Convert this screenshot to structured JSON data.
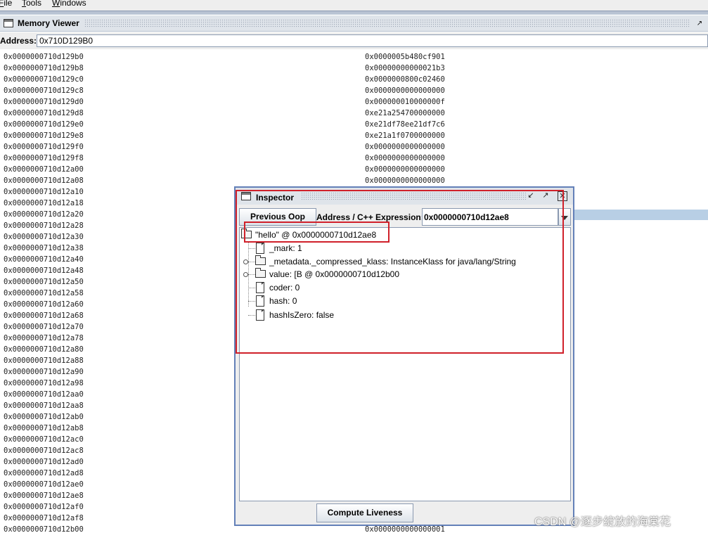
{
  "menubar": {
    "items": [
      {
        "label": "File",
        "mnemonic_index": 0
      },
      {
        "label": "Tools",
        "mnemonic_index": 0
      },
      {
        "label": "Windows",
        "mnemonic_index": 0
      }
    ]
  },
  "memory_viewer": {
    "title": "Memory Viewer",
    "address_label": "Address:",
    "address_value": "0x710D129B0",
    "rows": [
      {
        "addr": "0x0000000710d129b0",
        "val": "0x0000005b480cf901"
      },
      {
        "addr": "0x0000000710d129b8",
        "val": "0x00000000000021b3"
      },
      {
        "addr": "0x0000000710d129c0",
        "val": "0x0000000800c02460"
      },
      {
        "addr": "0x0000000710d129c8",
        "val": "0x0000000000000000"
      },
      {
        "addr": "0x0000000710d129d0",
        "val": "0x000000010000000f"
      },
      {
        "addr": "0x0000000710d129d8",
        "val": "0xe21a254700000000"
      },
      {
        "addr": "0x0000000710d129e0",
        "val": "0xe21df78ee21df7c6"
      },
      {
        "addr": "0x0000000710d129e8",
        "val": "0xe21a1f0700000000"
      },
      {
        "addr": "0x0000000710d129f0",
        "val": "0x0000000000000000"
      },
      {
        "addr": "0x0000000710d129f8",
        "val": "0x0000000000000000"
      },
      {
        "addr": "0x0000000710d12a00",
        "val": "0x0000000000000000"
      },
      {
        "addr": "0x0000000710d12a08",
        "val": "0x0000000000000000"
      },
      {
        "addr": "0x0000000710d12a10",
        "val": ""
      },
      {
        "addr": "0x0000000710d12a18",
        "val": ""
      },
      {
        "addr": "0x0000000710d12a20",
        "val": ""
      },
      {
        "addr": "0x0000000710d12a28",
        "val": ""
      },
      {
        "addr": "0x0000000710d12a30",
        "val": ""
      },
      {
        "addr": "0x0000000710d12a38",
        "val": ""
      },
      {
        "addr": "0x0000000710d12a40",
        "val": ""
      },
      {
        "addr": "0x0000000710d12a48",
        "val": ""
      },
      {
        "addr": "0x0000000710d12a50",
        "val": ""
      },
      {
        "addr": "0x0000000710d12a58",
        "val": ""
      },
      {
        "addr": "0x0000000710d12a60",
        "val": ""
      },
      {
        "addr": "0x0000000710d12a68",
        "val": ""
      },
      {
        "addr": "0x0000000710d12a70",
        "val": ""
      },
      {
        "addr": "0x0000000710d12a78",
        "val": ""
      },
      {
        "addr": "0x0000000710d12a80",
        "val": ""
      },
      {
        "addr": "0x0000000710d12a88",
        "val": ""
      },
      {
        "addr": "0x0000000710d12a90",
        "val": ""
      },
      {
        "addr": "0x0000000710d12a98",
        "val": ""
      },
      {
        "addr": "0x0000000710d12aa0",
        "val": ""
      },
      {
        "addr": "0x0000000710d12aa8",
        "val": ""
      },
      {
        "addr": "0x0000000710d12ab0",
        "val": ""
      },
      {
        "addr": "0x0000000710d12ab8",
        "val": ""
      },
      {
        "addr": "0x0000000710d12ac0",
        "val": ""
      },
      {
        "addr": "0x0000000710d12ac8",
        "val": ""
      },
      {
        "addr": "0x0000000710d12ad0",
        "val": ""
      },
      {
        "addr": "0x0000000710d12ad8",
        "val": ""
      },
      {
        "addr": "0x0000000710d12ae0",
        "val": ""
      },
      {
        "addr": "0x0000000710d12ae8",
        "val": ""
      },
      {
        "addr": "0x0000000710d12af0",
        "val": ""
      },
      {
        "addr": "0x0000000710d12af8",
        "val": ""
      },
      {
        "addr": "0x0000000710d12b00",
        "val": "0x0000000000000001"
      }
    ]
  },
  "inspector": {
    "title": "Inspector",
    "previous_oop_label": "Previous Oop",
    "expression_label": "Address / C++ Expression:",
    "expression_value": "0x0000000710d12ae8",
    "tree": {
      "root": "\"hello\" @ 0x0000000710d12ae8",
      "children": [
        {
          "label": "_mark: 1",
          "icon": "file-icon",
          "expandable": false
        },
        {
          "label": "_metadata._compressed_klass: InstanceKlass for java/lang/String",
          "icon": "folder-icon",
          "expandable": true
        },
        {
          "label": "value: [B @ 0x0000000710d12b00",
          "icon": "folder-icon",
          "expandable": true
        },
        {
          "label": "coder: 0",
          "icon": "file-icon",
          "expandable": false
        },
        {
          "label": "hash: 0",
          "icon": "file-icon",
          "expandable": false
        },
        {
          "label": "hashIsZero: false",
          "icon": "file-icon",
          "expandable": false
        }
      ]
    },
    "compute_liveness_label": "Compute Liveness"
  },
  "annotation_color": "#d0202a",
  "watermark": "CSDN @逐步绽放的海棠花"
}
